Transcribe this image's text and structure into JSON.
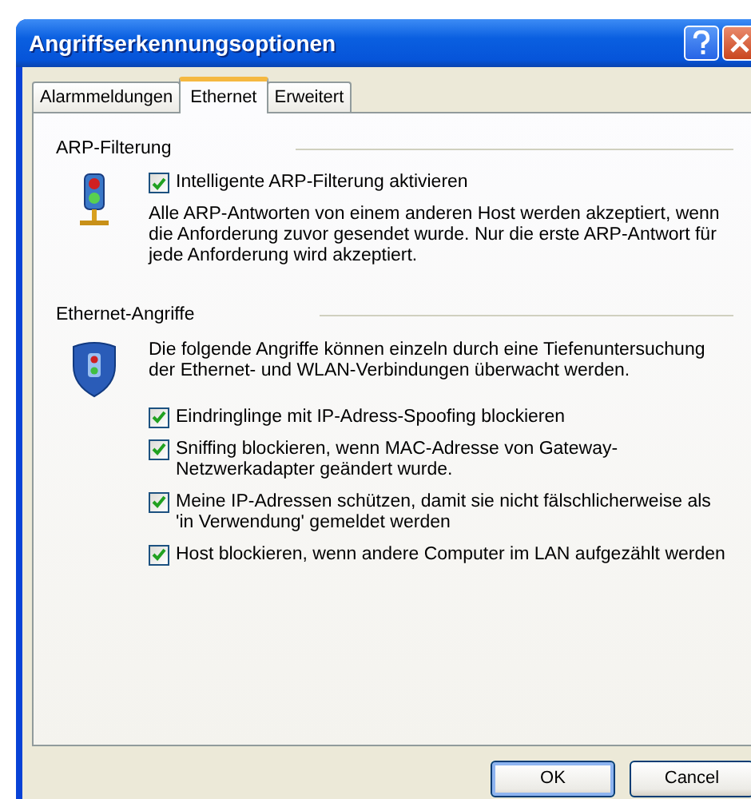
{
  "window": {
    "title": "Angriffserkennungsoptionen"
  },
  "tabs": [
    {
      "label": "Alarmmeldungen",
      "selected": false
    },
    {
      "label": "Ethernet",
      "selected": true
    },
    {
      "label": "Erweitert",
      "selected": false
    }
  ],
  "groups": [
    {
      "title": "ARP-Filterung",
      "kind": "toggle",
      "options": [
        {
          "label": "Intelligente ARP-Filterung aktivieren",
          "checked": true
        }
      ],
      "description": "Alle ARP-Antworten von einem anderen Host werden akzeptiert, wenn die Anforderung zuvor gesendet wurde. Nur die erste ARP-Antwort für jede Anforderung wird akzeptiert."
    },
    {
      "title": "Ethernet-Angriffe",
      "kind": "list",
      "description": "Die folgende Angriffe können einzeln durch eine Tiefenuntersuchung der Ethernet- und WLAN-Verbindungen überwacht werden.",
      "options": [
        {
          "label": "Eindringlinge mit IP-Adress-Spoofing blockieren",
          "checked": true
        },
        {
          "label": "Sniffing blockieren, wenn MAC-Adresse von Gateway-Netzwerkadapter geändert wurde.",
          "checked": true
        },
        {
          "label": "Meine IP-Adressen schützen, damit sie nicht fälschlicherweise als 'in Verwendung' gemeldet werden",
          "checked": true
        },
        {
          "label": "Host blockieren, wenn andere Computer im LAN aufgezählt werden",
          "checked": true
        }
      ]
    }
  ],
  "buttons": [
    {
      "label": "OK",
      "default": true
    },
    {
      "label": "Cancel",
      "default": false
    }
  ]
}
